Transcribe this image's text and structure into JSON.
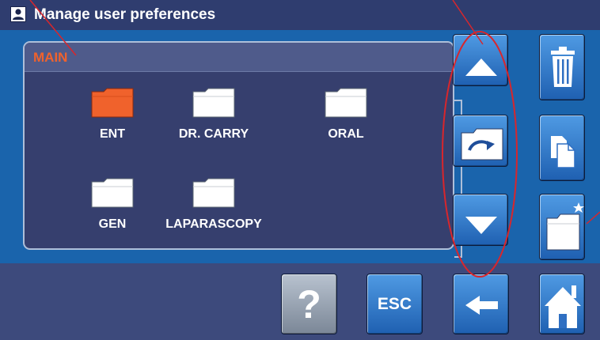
{
  "titlebar": {
    "title": "Manage user preferences"
  },
  "panel": {
    "title": "MAIN",
    "folders": [
      {
        "label": "ENT",
        "selected": true
      },
      {
        "label": "DR. CARRY",
        "selected": false
      },
      {
        "label": "ORAL",
        "selected": false
      },
      {
        "label": "GEN",
        "selected": false
      },
      {
        "label": "LAPARASCOPY",
        "selected": false
      }
    ]
  },
  "buttons": {
    "help_label": "?",
    "esc_label": "ESC"
  },
  "icons": {
    "title": "user-profile-icon",
    "scroll_up": "arrow-up-icon",
    "move_folder": "move-folder-icon",
    "scroll_down": "arrow-down-icon",
    "delete": "trash-icon",
    "copy": "copy-icon",
    "new_folder": "new-folder-icon",
    "back": "arrow-left-icon",
    "home": "home-icon"
  },
  "colors": {
    "titlebar": "#2f3d6f",
    "main_background": "#1a64ac",
    "panel_background": "#363f6e",
    "panel_title": "#f0622c",
    "selected_folder": "#f0622c",
    "folder": "#ffffff",
    "button": "#3a86d6",
    "help_button": "#9aa4b1",
    "annotation": "#d8262c"
  }
}
